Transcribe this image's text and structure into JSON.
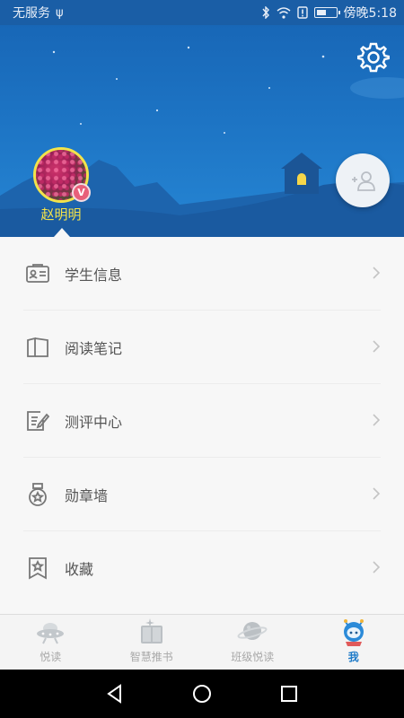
{
  "status_bar": {
    "carrier": "无服务",
    "time": "傍晚5:18",
    "icons": [
      "usb-icon",
      "bluetooth-icon",
      "wifi-icon",
      "alert-icon",
      "battery-icon"
    ]
  },
  "profile": {
    "name": "赵明明",
    "badge": "V"
  },
  "menu": {
    "items": [
      {
        "label": "学生信息",
        "icon": "id-card-icon"
      },
      {
        "label": "阅读笔记",
        "icon": "book-icon"
      },
      {
        "label": "测评中心",
        "icon": "edit-note-icon"
      },
      {
        "label": "勋章墙",
        "icon": "medal-icon"
      },
      {
        "label": "收藏",
        "icon": "bookmark-star-icon"
      }
    ]
  },
  "tabs": [
    {
      "label": "悦读",
      "icon": "ufo-icon",
      "active": false
    },
    {
      "label": "智慧推书",
      "icon": "book-stack-icon",
      "active": false
    },
    {
      "label": "班级悦读",
      "icon": "planet-icon",
      "active": false
    },
    {
      "label": "我",
      "icon": "astronaut-icon",
      "active": true
    }
  ],
  "colors": {
    "header": "#1d74c4",
    "username": "#f5e44a",
    "active_tab": "#1d7ac8",
    "badge": "#e8607a"
  }
}
